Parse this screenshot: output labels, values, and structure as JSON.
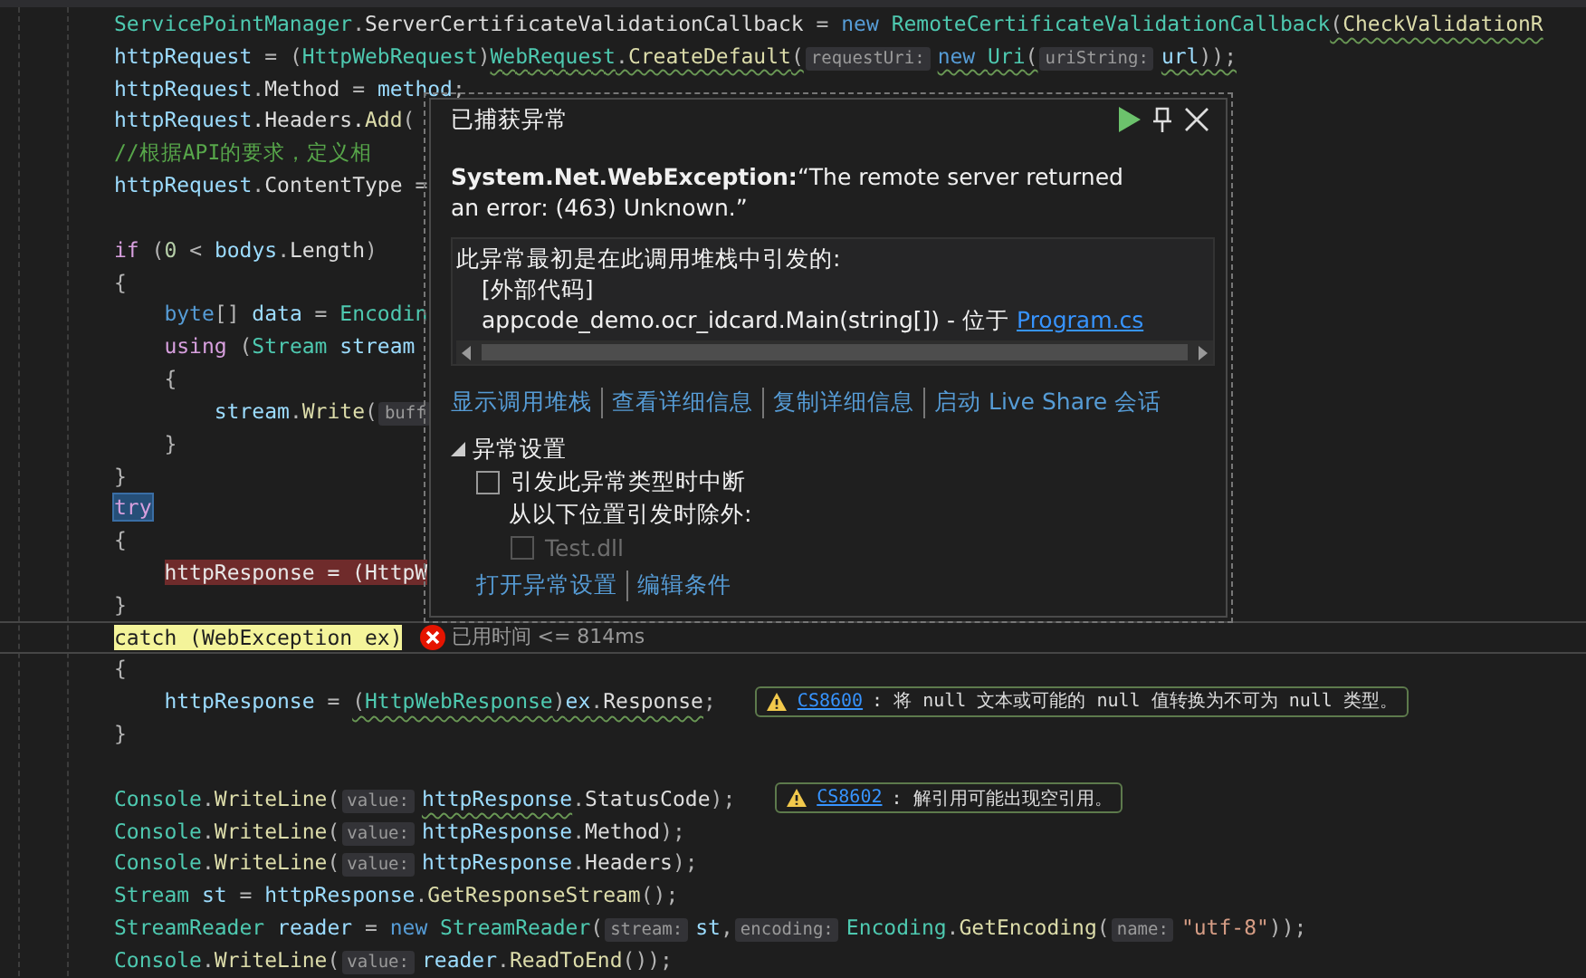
{
  "code_lines": [
    {
      "kind": "code",
      "tokens": [
        {
          "text": "ServicePointManager",
          "kind": "type"
        },
        {
          "text": ".",
          "kind": "punc"
        },
        {
          "text": "ServerCertificateValidationCallback",
          "kind": "member"
        },
        {
          "text": " = ",
          "kind": "punc"
        },
        {
          "text": "new ",
          "kind": "kw"
        },
        {
          "text": "RemoteCertificateValidationCallback",
          "kind": "type"
        },
        {
          "text": "(",
          "kind": "punc",
          "squiggle": true
        },
        {
          "text": "CheckValidationR",
          "kind": "method",
          "squiggle": true
        }
      ]
    },
    {
      "kind": "code",
      "tokens": [
        {
          "text": "httpRequest",
          "kind": "var"
        },
        {
          "text": " = (",
          "kind": "punc"
        },
        {
          "text": "HttpWebRequest",
          "kind": "type"
        },
        {
          "text": ")",
          "kind": "punc"
        },
        {
          "text": "WebRequest",
          "kind": "type",
          "squiggle": true
        },
        {
          "text": ".",
          "kind": "punc",
          "squiggle": true
        },
        {
          "text": "CreateDefault",
          "kind": "method",
          "squiggle": true
        },
        {
          "text": "(",
          "kind": "punc",
          "squiggle": true
        },
        {
          "text": "requestUri:",
          "kind": "hint"
        },
        {
          "text": "new ",
          "kind": "kw",
          "squiggle": true
        },
        {
          "text": "Uri",
          "kind": "type",
          "squiggle": true
        },
        {
          "text": "(",
          "kind": "punc",
          "squiggle": true
        },
        {
          "text": "uriString:",
          "kind": "hint"
        },
        {
          "text": "url",
          "kind": "var",
          "squiggle": true
        },
        {
          "text": "));",
          "kind": "punc",
          "squiggle": true
        }
      ]
    },
    {
      "kind": "code",
      "tokens": [
        {
          "text": "httpRequest",
          "kind": "var"
        },
        {
          "text": ".",
          "kind": "punc"
        },
        {
          "text": "Method",
          "kind": "member"
        },
        {
          "text": " = ",
          "kind": "punc"
        },
        {
          "text": "method",
          "kind": "var"
        },
        {
          "text": ";",
          "kind": "punc"
        }
      ]
    },
    {
      "kind": "code",
      "tokens": [
        {
          "text": "httpRequest",
          "kind": "var"
        },
        {
          "text": ".Headers.",
          "kind": "member"
        },
        {
          "text": "Add",
          "kind": "method"
        },
        {
          "text": "(",
          "kind": "punc"
        }
      ]
    },
    {
      "kind": "code",
      "tokens": [
        {
          "text": "//根据API的要求，定义相",
          "kind": "cmt"
        }
      ]
    },
    {
      "kind": "code",
      "tokens": [
        {
          "text": "httpRequest",
          "kind": "var"
        },
        {
          "text": ".",
          "kind": "punc"
        },
        {
          "text": "ContentType",
          "kind": "member"
        },
        {
          "text": " =",
          "kind": "punc"
        }
      ]
    },
    {
      "kind": "blank"
    },
    {
      "kind": "code",
      "tokens": [
        {
          "text": "if",
          "kind": "ctl"
        },
        {
          "text": " (",
          "kind": "punc"
        },
        {
          "text": "0",
          "kind": "num"
        },
        {
          "text": " < ",
          "kind": "punc"
        },
        {
          "text": "bodys",
          "kind": "var"
        },
        {
          "text": ".",
          "kind": "punc"
        },
        {
          "text": "Length",
          "kind": "member"
        },
        {
          "text": ")",
          "kind": "punc"
        }
      ]
    },
    {
      "kind": "code",
      "tokens": [
        {
          "text": "{",
          "kind": "punc"
        }
      ]
    },
    {
      "kind": "code",
      "tokens": [
        {
          "text": "    byte",
          "kind": "kw"
        },
        {
          "text": "[] ",
          "kind": "punc"
        },
        {
          "text": "data",
          "kind": "var"
        },
        {
          "text": " = ",
          "kind": "punc"
        },
        {
          "text": "Encodin",
          "kind": "type"
        }
      ]
    },
    {
      "kind": "code",
      "tokens": [
        {
          "text": "    using",
          "kind": "ctl"
        },
        {
          "text": " (",
          "kind": "punc"
        },
        {
          "text": "Stream",
          "kind": "type"
        },
        {
          "text": " stream",
          "kind": "var"
        }
      ]
    },
    {
      "kind": "code",
      "tokens": [
        {
          "text": "    {",
          "kind": "punc"
        }
      ]
    },
    {
      "kind": "code",
      "tokens": [
        {
          "text": "        stream",
          "kind": "var"
        },
        {
          "text": ".",
          "kind": "punc"
        },
        {
          "text": "Write",
          "kind": "method"
        },
        {
          "text": "(",
          "kind": "punc"
        },
        {
          "text": "buff",
          "kind": "hint"
        }
      ]
    },
    {
      "kind": "code",
      "tokens": [
        {
          "text": "    }",
          "kind": "punc"
        }
      ]
    },
    {
      "kind": "code",
      "tokens": [
        {
          "text": "}",
          "kind": "punc"
        }
      ]
    },
    {
      "kind": "code",
      "tokens": [
        {
          "text": "try",
          "kind": "selection"
        }
      ]
    },
    {
      "kind": "code",
      "tokens": [
        {
          "text": "{",
          "kind": "punc"
        }
      ]
    },
    {
      "kind": "code",
      "tokens": [
        {
          "text": "    httpResponse = (HttpW",
          "kind": "error"
        }
      ]
    },
    {
      "kind": "code",
      "tokens": [
        {
          "text": "}",
          "kind": "punc"
        }
      ]
    },
    {
      "kind": "current",
      "elapsed": "已用时间 <= 814ms",
      "tokens": [
        {
          "text": "catch (WebException ex)",
          "kind": "next"
        }
      ]
    },
    {
      "kind": "code",
      "tokens": [
        {
          "text": "{",
          "kind": "punc"
        }
      ]
    },
    {
      "kind": "code",
      "warning": {
        "code": "CS8600",
        "message": ": 将 null 文本或可能的 null 值转换为不可为 null 类型。"
      },
      "tokens": [
        {
          "text": "    httpResponse",
          "kind": "var"
        },
        {
          "text": " = ",
          "kind": "punc"
        },
        {
          "text": "(",
          "kind": "punc",
          "squiggle": true
        },
        {
          "text": "HttpWebResponse",
          "kind": "type",
          "squiggle": true
        },
        {
          "text": ")",
          "kind": "punc",
          "squiggle": true
        },
        {
          "text": "ex",
          "kind": "var",
          "squiggle": true
        },
        {
          "text": ".",
          "kind": "punc",
          "squiggle": true
        },
        {
          "text": "Response",
          "kind": "member",
          "squiggle": true
        },
        {
          "text": ";",
          "kind": "punc"
        }
      ]
    },
    {
      "kind": "code",
      "tokens": [
        {
          "text": "}",
          "kind": "punc"
        }
      ]
    },
    {
      "kind": "blank"
    },
    {
      "kind": "code",
      "warning": {
        "code": "CS8602",
        "message": ": 解引用可能出现空引用。"
      },
      "tokens": [
        {
          "text": "Console",
          "kind": "type"
        },
        {
          "text": ".",
          "kind": "punc"
        },
        {
          "text": "WriteLine",
          "kind": "method"
        },
        {
          "text": "(",
          "kind": "punc"
        },
        {
          "text": "value:",
          "kind": "hint"
        },
        {
          "text": "httpResponse",
          "kind": "var",
          "squiggle": true
        },
        {
          "text": ".",
          "kind": "punc"
        },
        {
          "text": "StatusCode",
          "kind": "member"
        },
        {
          "text": ");",
          "kind": "punc"
        }
      ]
    },
    {
      "kind": "code",
      "tokens": [
        {
          "text": "Console",
          "kind": "type"
        },
        {
          "text": ".",
          "kind": "punc"
        },
        {
          "text": "WriteLine",
          "kind": "method"
        },
        {
          "text": "(",
          "kind": "punc"
        },
        {
          "text": "value:",
          "kind": "hint"
        },
        {
          "text": "httpResponse",
          "kind": "var"
        },
        {
          "text": ".",
          "kind": "punc"
        },
        {
          "text": "Method",
          "kind": "member"
        },
        {
          "text": ");",
          "kind": "punc"
        }
      ]
    },
    {
      "kind": "code",
      "tokens": [
        {
          "text": "Console",
          "kind": "type"
        },
        {
          "text": ".",
          "kind": "punc"
        },
        {
          "text": "WriteLine",
          "kind": "method"
        },
        {
          "text": "(",
          "kind": "punc"
        },
        {
          "text": "value:",
          "kind": "hint"
        },
        {
          "text": "httpResponse",
          "kind": "var"
        },
        {
          "text": ".",
          "kind": "punc"
        },
        {
          "text": "Headers",
          "kind": "member"
        },
        {
          "text": ");",
          "kind": "punc"
        }
      ]
    },
    {
      "kind": "code",
      "tokens": [
        {
          "text": "Stream",
          "kind": "type"
        },
        {
          "text": " st",
          "kind": "var"
        },
        {
          "text": " = ",
          "kind": "punc"
        },
        {
          "text": "httpResponse",
          "kind": "var"
        },
        {
          "text": ".",
          "kind": "punc"
        },
        {
          "text": "GetResponseStream",
          "kind": "method"
        },
        {
          "text": "();",
          "kind": "punc"
        }
      ]
    },
    {
      "kind": "code",
      "tokens": [
        {
          "text": "StreamReader",
          "kind": "type"
        },
        {
          "text": " reader",
          "kind": "var"
        },
        {
          "text": " = ",
          "kind": "punc"
        },
        {
          "text": "new ",
          "kind": "kw"
        },
        {
          "text": "StreamReader",
          "kind": "type"
        },
        {
          "text": "(",
          "kind": "punc"
        },
        {
          "text": "stream:",
          "kind": "hint"
        },
        {
          "text": "st",
          "kind": "var"
        },
        {
          "text": ",",
          "kind": "punc"
        },
        {
          "text": "encoding:",
          "kind": "hint"
        },
        {
          "text": "Encoding",
          "kind": "type"
        },
        {
          "text": ".",
          "kind": "punc"
        },
        {
          "text": "GetEncoding",
          "kind": "method"
        },
        {
          "text": "(",
          "kind": "punc"
        },
        {
          "text": "name:",
          "kind": "hint"
        },
        {
          "text": "\"utf-8\"",
          "kind": "str"
        },
        {
          "text": "));",
          "kind": "punc"
        }
      ]
    },
    {
      "kind": "code",
      "tokens": [
        {
          "text": "Console",
          "kind": "type"
        },
        {
          "text": ".",
          "kind": "punc"
        },
        {
          "text": "WriteLine",
          "kind": "method"
        },
        {
          "text": "(",
          "kind": "punc"
        },
        {
          "text": "value:",
          "kind": "hint"
        },
        {
          "text": "reader",
          "kind": "var"
        },
        {
          "text": ".",
          "kind": "punc"
        },
        {
          "text": "ReadToEnd",
          "kind": "method"
        },
        {
          "text": "());",
          "kind": "punc"
        }
      ]
    }
  ],
  "exception_popup": {
    "title": "已捕获异常",
    "message": "**System.Net.WebException:**“The remote server returned an error: (463) Unknown.”",
    "stack": {
      "heading": "此异常最初是在此调用堆栈中引发的:",
      "frames": [
        {
          "text": "[外部代码]"
        },
        {
          "text": "appcode_demo.ocr_idcard.Main(string[]) - 位于",
          "link": "Program.cs"
        }
      ]
    },
    "actions": [
      "显示调用堆栈",
      "查看详细信息",
      "复制详细信息",
      "启动 Live Share 会话"
    ],
    "settings": {
      "title": "异常设置",
      "expanded": true,
      "break_when_thrown": {
        "label": "引发此异常类型时中断",
        "checked": false
      },
      "except_label": "从以下位置引发时除外:",
      "exceptions": [
        {
          "label": "Test.dll",
          "checked": false,
          "disabled": true
        }
      ]
    },
    "links": [
      "打开异常设置",
      "编辑条件"
    ]
  }
}
